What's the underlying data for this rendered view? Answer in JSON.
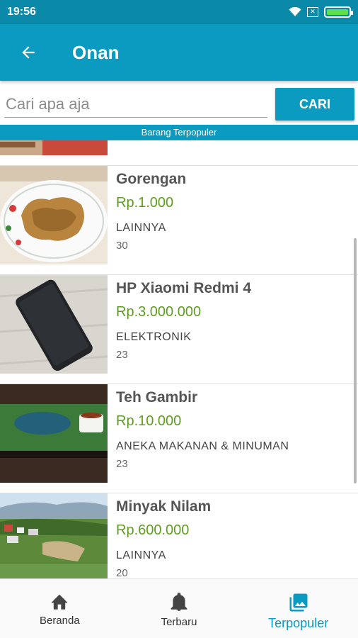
{
  "status_bar": {
    "time": "19:56",
    "battery_level": 1.0
  },
  "app_bar": {
    "title": "Onan",
    "back_icon": "arrow-left-icon"
  },
  "search": {
    "placeholder": "Cari apa aja",
    "value": "",
    "button_label": "CARI"
  },
  "section": {
    "label": "Barang Terpopuler"
  },
  "products": [
    {
      "name": "Gorengan",
      "price": "Rp.1.000",
      "category": "LAINNYA",
      "count": "30"
    },
    {
      "name": "HP Xiaomi Redmi 4",
      "price": "Rp.3.000.000",
      "category": "ELEKTRONIK",
      "count": "23"
    },
    {
      "name": "Teh Gambir",
      "price": "Rp.10.000",
      "category": "ANEKA MAKANAN & MINUMAN",
      "count": "23"
    },
    {
      "name": "Minyak Nilam",
      "price": "Rp.600.000",
      "category": "LAINNYA",
      "count": "20"
    }
  ],
  "bottom_nav": [
    {
      "label": "Beranda",
      "icon": "home-icon",
      "active": false
    },
    {
      "label": "Terbaru",
      "icon": "bell-icon",
      "active": false
    },
    {
      "label": "Terpopuler",
      "icon": "image-icon",
      "active": true
    }
  ],
  "colors": {
    "primary": "#0b9bc0",
    "status_bar": "#0a8aa8",
    "price": "#5e9e1e",
    "battery": "#5ee04a"
  }
}
